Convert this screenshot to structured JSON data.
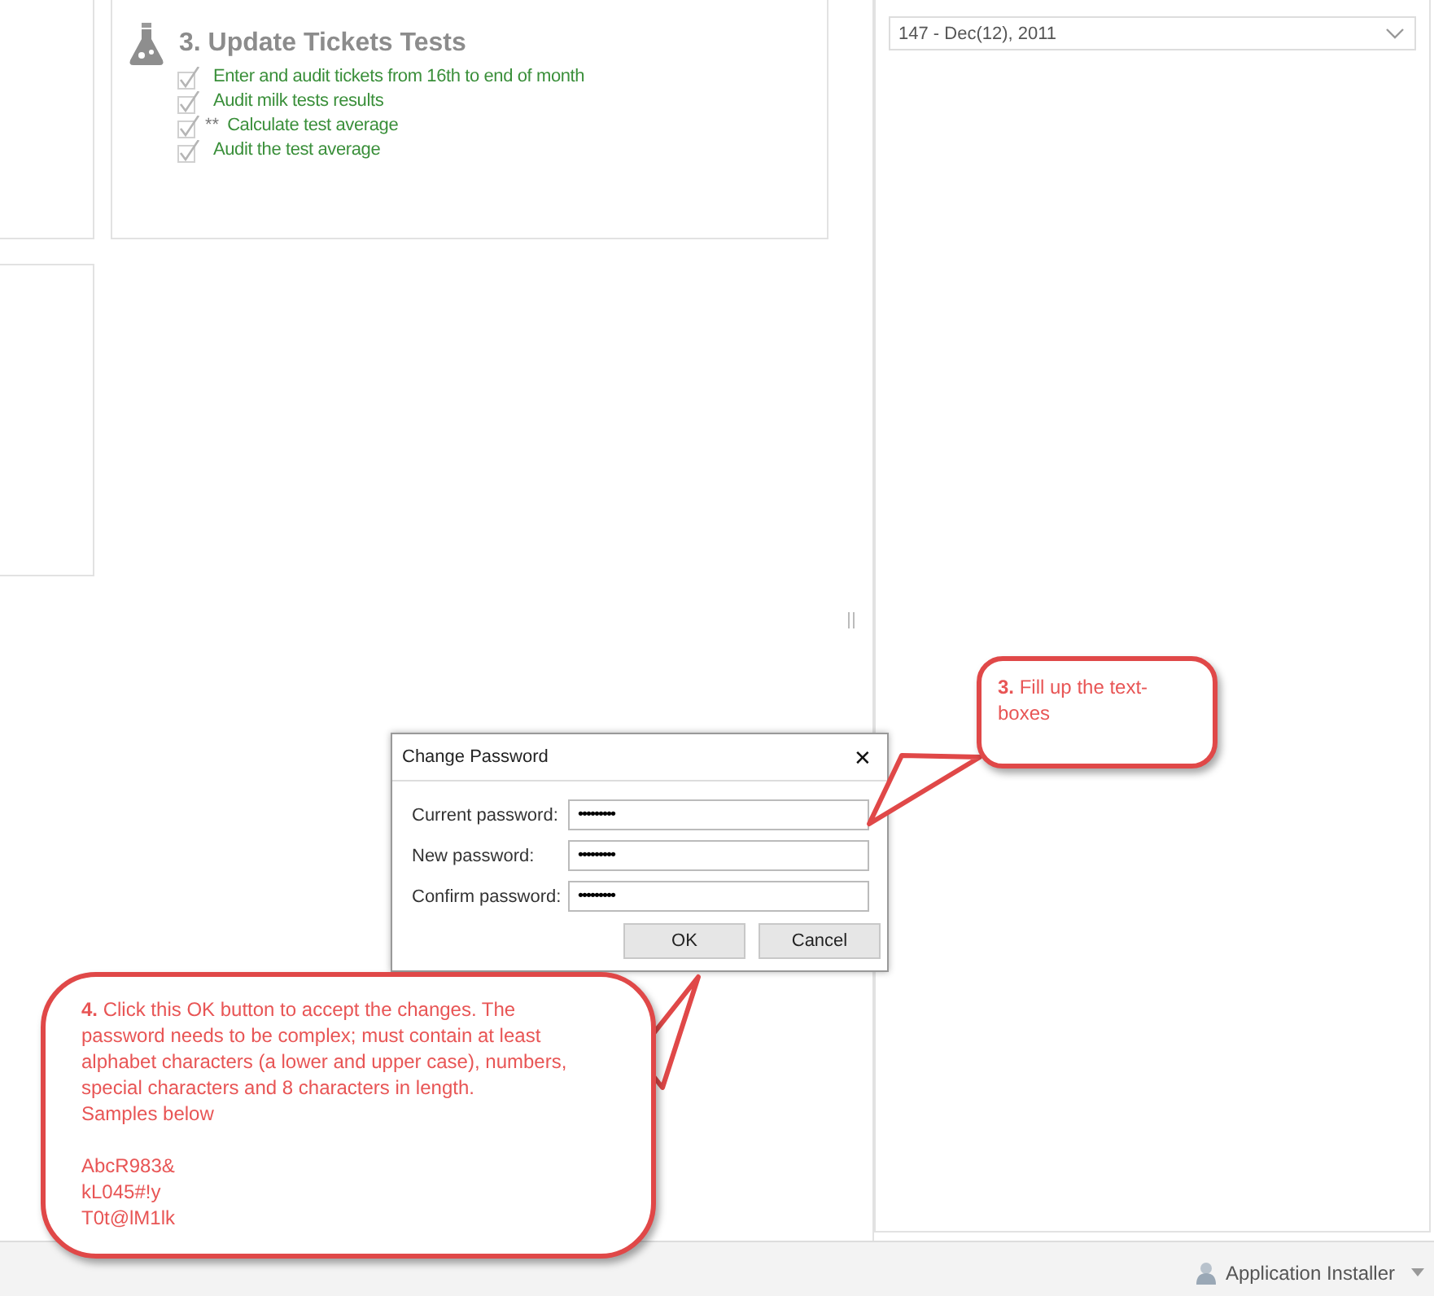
{
  "task_card": {
    "title": "3. Update Tickets Tests",
    "items": [
      {
        "text": "Enter and audit tickets from 16th to end of month",
        "checked": true
      },
      {
        "text": "Audit milk tests results",
        "checked": true
      },
      {
        "prefix": "**",
        "text": "Calculate test average",
        "checked": true
      },
      {
        "text": "Audit the test average",
        "checked": true
      }
    ]
  },
  "period_select": {
    "value": "147 - Dec(12), 2011"
  },
  "dialog": {
    "title": "Change Password",
    "close": "✕",
    "fields": [
      {
        "label": "Current password:",
        "value": "•••••••••"
      },
      {
        "label": "New password:",
        "value": "•••••••••"
      },
      {
        "label": "Confirm password:",
        "value": "•••••••••"
      }
    ],
    "buttons": [
      "OK",
      "Cancel"
    ]
  },
  "callouts": [
    {
      "kind": "right",
      "text": "**3.** Fill up the text-boxes"
    },
    {
      "kind": "left",
      "text": "**4.** Click this OK button to accept the changes. The password needs to be complex; must contain at least alphabet characters (a lower and upper case), numbers, special characters and 8 characters in length.",
      "note": "Samples below",
      "samples": [
        "AbcR983&",
        "kL045#!y",
        "T0t@lM1lk"
      ]
    }
  ],
  "status_bar": {
    "user": "Application Installer"
  }
}
